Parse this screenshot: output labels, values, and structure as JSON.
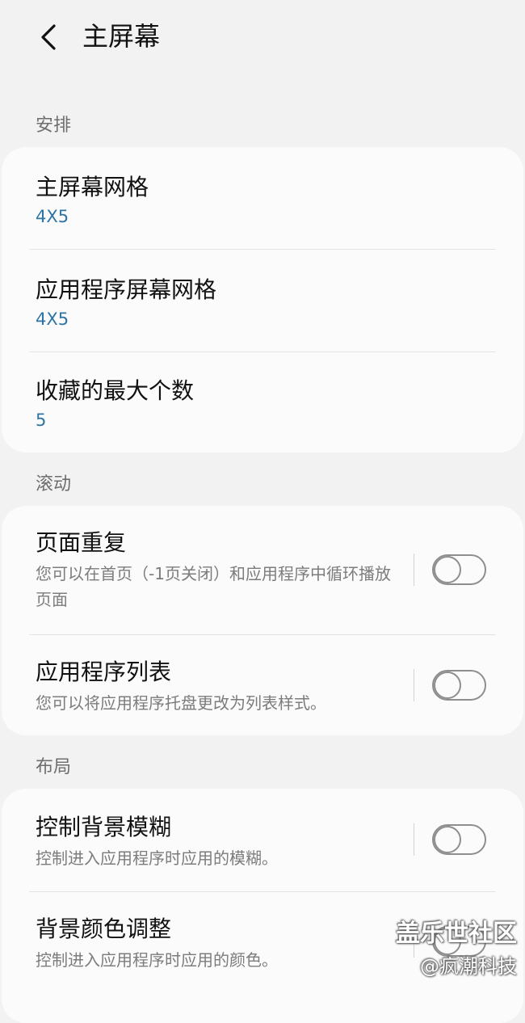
{
  "header": {
    "back_icon": "chevron-left-icon",
    "title": "主屏幕"
  },
  "sections": {
    "arrange": {
      "label": "安排",
      "items": [
        {
          "title": "主屏幕网格",
          "value": "4X5"
        },
        {
          "title": "应用程序屏幕网格",
          "value": "4X5"
        },
        {
          "title": "收藏的最大个数",
          "value": "5"
        }
      ]
    },
    "scroll": {
      "label": "滚动",
      "items": [
        {
          "title": "页面重复",
          "desc": "您可以在首页（-1页关闭）和应用程序中循环播放页面",
          "toggle_on": false
        },
        {
          "title": "应用程序列表",
          "desc": "您可以将应用程序托盘更改为列表样式。",
          "toggle_on": false
        }
      ]
    },
    "layout": {
      "label": "布局",
      "items": [
        {
          "title": "控制背景模糊",
          "desc": "控制进入应用程序时应用的模糊。",
          "toggle_on": false
        },
        {
          "title": "背景颜色调整",
          "desc": "控制进入应用程序时应用的颜色。",
          "toggle_on": false
        }
      ]
    }
  },
  "watermark": {
    "line1": "盖乐世社区",
    "line2": "@疯潮科技"
  },
  "colors": {
    "background": "#f2f2f2",
    "card": "#fbfbfb",
    "value_blue": "#2e74a5",
    "secondary_text": "#7c7c7c"
  }
}
